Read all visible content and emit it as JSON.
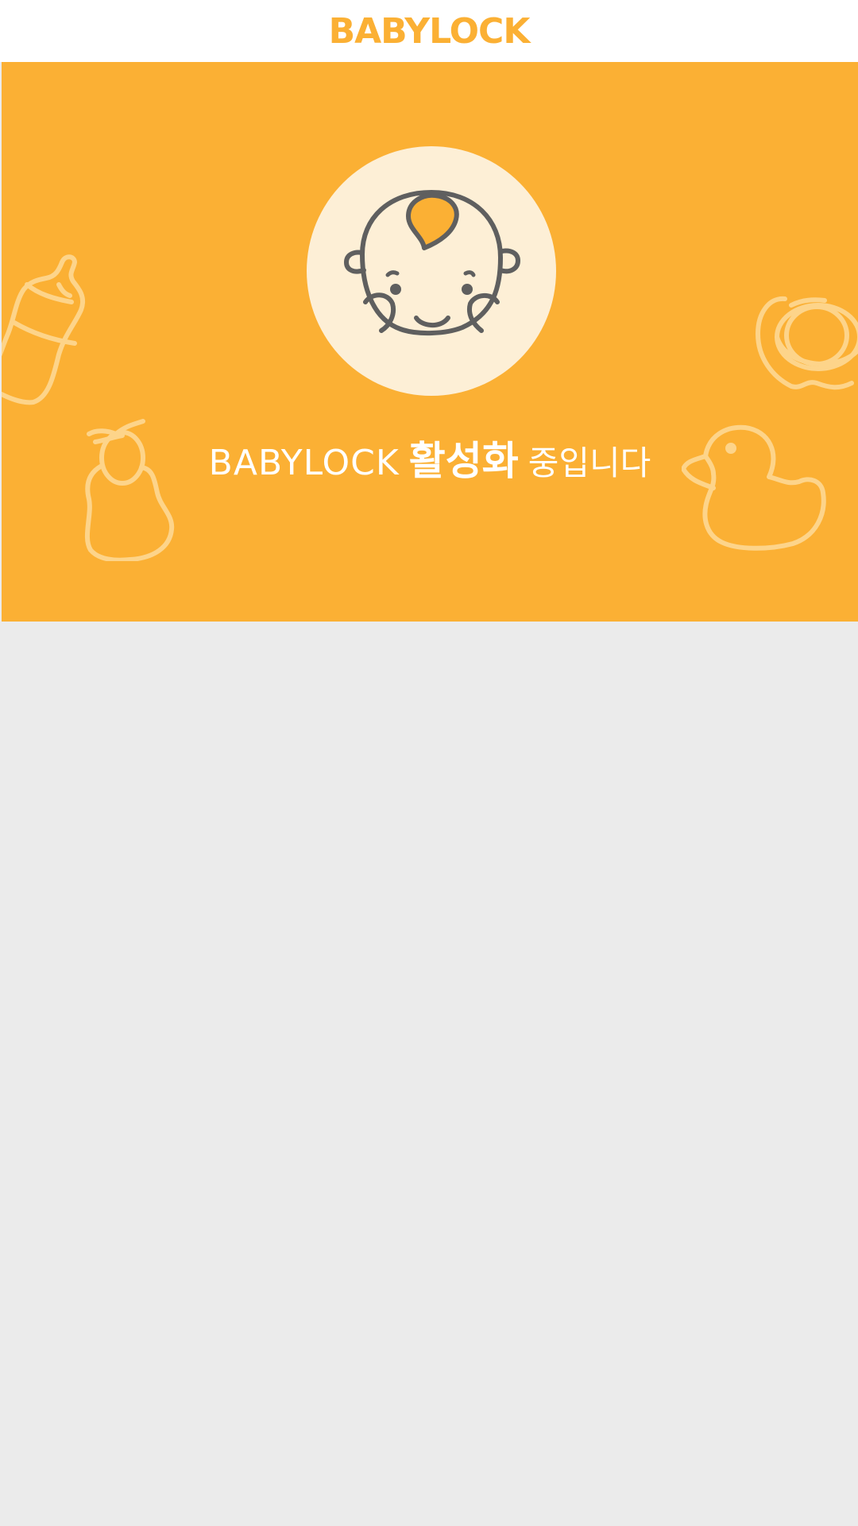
{
  "header": {
    "title": "BABYLOCK"
  },
  "hero": {
    "status_brand": "BABYLOCK",
    "status_emphasis": "활성화",
    "status_suffix": "중입니다"
  },
  "colors": {
    "accent": "#fbb034",
    "header_bg": "#ffffff",
    "avatar_bg": "#fdefd6",
    "line_art": "#5f5f5f",
    "deco_line": "#fdd48a",
    "page_bg": "#ebebeb"
  },
  "icons": {
    "avatar": "baby-face-icon",
    "decorations": [
      "baby-bottle-icon",
      "rattle-icon",
      "pacifier-icon",
      "rubber-duck-icon"
    ]
  }
}
